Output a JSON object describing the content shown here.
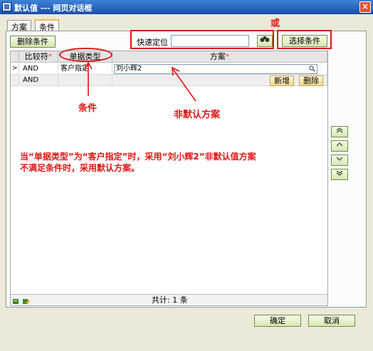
{
  "window": {
    "title": "默认值 --- 网页对话框",
    "close": "×"
  },
  "tabs": [
    {
      "label": "方案"
    },
    {
      "label": "条件"
    }
  ],
  "toolbar": {
    "delete_condition": "删除条件",
    "quick_locate_label": "快速定位",
    "quick_locate_value": "",
    "binoculars": "🔭",
    "select_condition": "选择条件"
  },
  "grid": {
    "headers": {
      "compare": "比较符",
      "required_mark": "*",
      "doc_type": "单据类型",
      "scheme": "方案"
    },
    "rows": [
      {
        "marker": ">",
        "compare": "AND",
        "doc_type": "客户指定",
        "scheme": "刘小辉2"
      },
      {
        "marker": "",
        "compare": "AND",
        "doc_type": "",
        "scheme": ""
      }
    ],
    "add": "新增",
    "delete": "删除",
    "total": "共计: 1 条"
  },
  "nav": [
    "⌃⌃",
    "⌃",
    "⌄",
    "⌄⌄"
  ],
  "annotations": {
    "or": "或",
    "condition": "条件",
    "non_default": "非默认方案",
    "explanation_line1": "当“单据类型”为“客户指定”时，采用“刘小辉2”非默认值方案",
    "explanation_line2": "不满足条件时，采用默认方案。"
  },
  "footer": {
    "ok": "确定",
    "cancel": "取消"
  },
  "colors": {
    "annotation": "#e01414",
    "title_bar": "#1a4ea6"
  }
}
